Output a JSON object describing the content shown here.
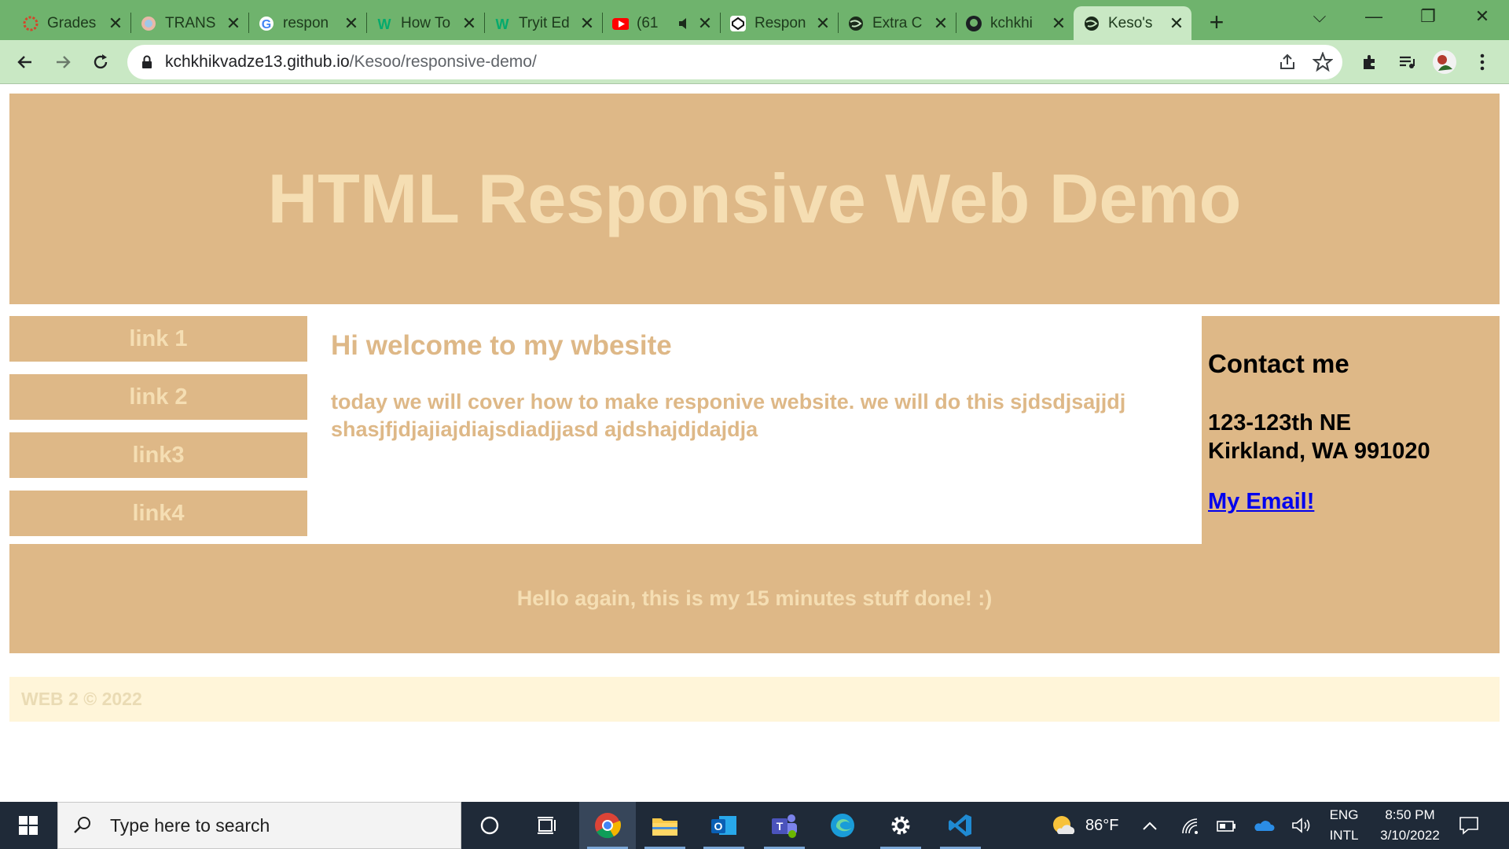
{
  "browser": {
    "tabs": [
      {
        "title": "Grades",
        "icon": "canvas-icon"
      },
      {
        "title": "TRANS",
        "icon": "translate-icon"
      },
      {
        "title": "respon",
        "icon": "google-icon"
      },
      {
        "title": "How To",
        "icon": "w-icon"
      },
      {
        "title": "Tryit Ed",
        "icon": "w-icon"
      },
      {
        "title": "(61",
        "icon": "youtube-icon"
      },
      {
        "title": "Respon",
        "icon": "codepen-icon"
      },
      {
        "title": "Extra C",
        "icon": "globe-icon"
      },
      {
        "title": "kchkhi",
        "icon": "github-icon"
      },
      {
        "title": "Keso's",
        "icon": "globe-icon"
      }
    ],
    "url_host": "kchkhikvadze13.github.io",
    "url_path": "/Kesoo/responsive-demo/"
  },
  "page": {
    "header_title": "HTML Responsive Web Demo",
    "nav_links": [
      "link 1",
      "link 2",
      "link3",
      "link4"
    ],
    "main_heading": "Hi welcome to my wbesite",
    "main_text": "today we will cover how to make responive website. we will do this sjdsdjsajjdj shasjfjdjajiajdiajsdiadjjasd ajdshajdjdajdja",
    "contact_heading": "Contact me",
    "address_line1": "123-123th NE",
    "address_line2": "Kirkland, WA 991020",
    "email_link": "My Email!",
    "footer_text": "Hello again, this is my 15 minutes stuff done! :)",
    "copyright": "WEB 2 © 2022"
  },
  "taskbar": {
    "search_placeholder": "Type here to search",
    "weather_temp": "86°F",
    "lang_top": "ENG",
    "lang_bottom": "INTL",
    "time": "8:50 PM",
    "date": "3/10/2022"
  },
  "colors": {
    "burlywood": "#deb887",
    "wheat": "#f5deb3",
    "tab_bar": "#6fb36d",
    "toolbar": "#c9e8c4"
  }
}
